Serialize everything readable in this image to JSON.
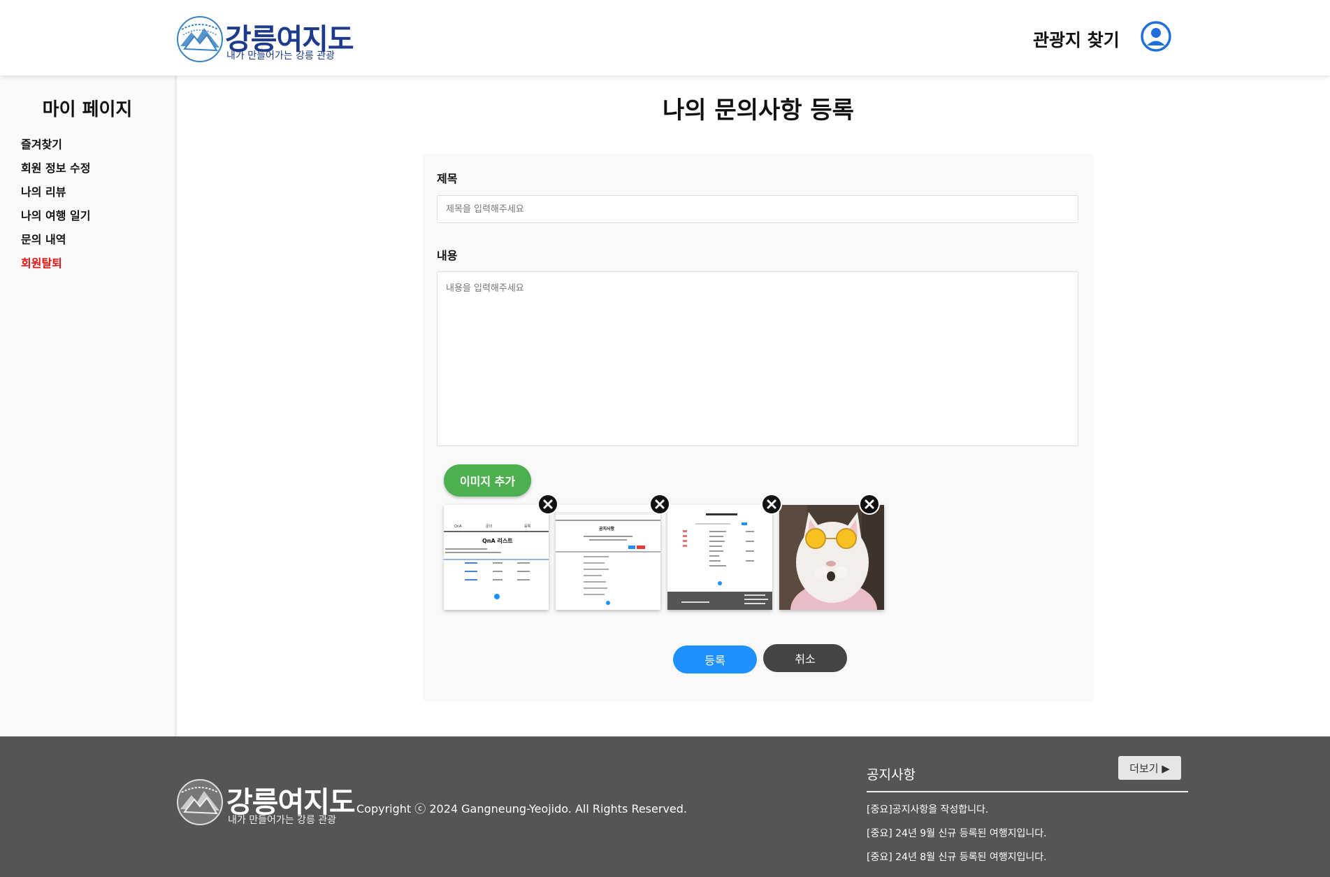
{
  "header": {
    "logo_title": "강릉여지도",
    "logo_subtitle": "내가 만들어가는 강릉 관광",
    "nav_link": "관광지 찾기"
  },
  "sidebar": {
    "title": "마이 페이지",
    "items": [
      {
        "label": "즐겨찾기"
      },
      {
        "label": "회원 정보 수정"
      },
      {
        "label": "나의 리뷰"
      },
      {
        "label": "나의 여행 일기"
      },
      {
        "label": "문의 내역"
      },
      {
        "label": "회원탈퇴"
      }
    ]
  },
  "main": {
    "page_title": "나의 문의사항 등록",
    "title_label": "제목",
    "title_placeholder": "제목을 입력해주세요",
    "content_label": "내용",
    "content_placeholder": "내용을 입력해주세요",
    "add_image_label": "이미지 추가",
    "thumbnails": [
      {
        "kind": "screenshot",
        "caption": "QnA 리스트"
      },
      {
        "kind": "screenshot",
        "caption": "공지사항"
      },
      {
        "kind": "screenshot",
        "caption": ""
      },
      {
        "kind": "photo",
        "caption": ""
      }
    ],
    "submit_label": "등록",
    "cancel_label": "취소"
  },
  "footer": {
    "logo_title": "강릉여지도",
    "logo_subtitle": "내가 만들어가는 강릉 관광",
    "copyright": "Copyright ⓒ 2024 Gangneung-Yeojido. All Rights Reserved.",
    "notice_title": "공지사항",
    "more_label": "더보기 ▶",
    "notices": [
      {
        "text": "[중요]공지사항을 작성합니다."
      },
      {
        "text": "[중요] 24년 9월 신규 등록된 여행지입니다."
      },
      {
        "text": "[중요] 24년 8월 신규 등록된 여행지입니다."
      }
    ]
  },
  "colors": {
    "brand_navy": "#1e3a8a",
    "user_icon_blue": "#1e6fd9",
    "add_image_green": "#4caf50",
    "submit_blue": "#1e90ff",
    "cancel_dark": "#444444",
    "danger_red": "#e31414",
    "footer_bg": "#555555"
  }
}
